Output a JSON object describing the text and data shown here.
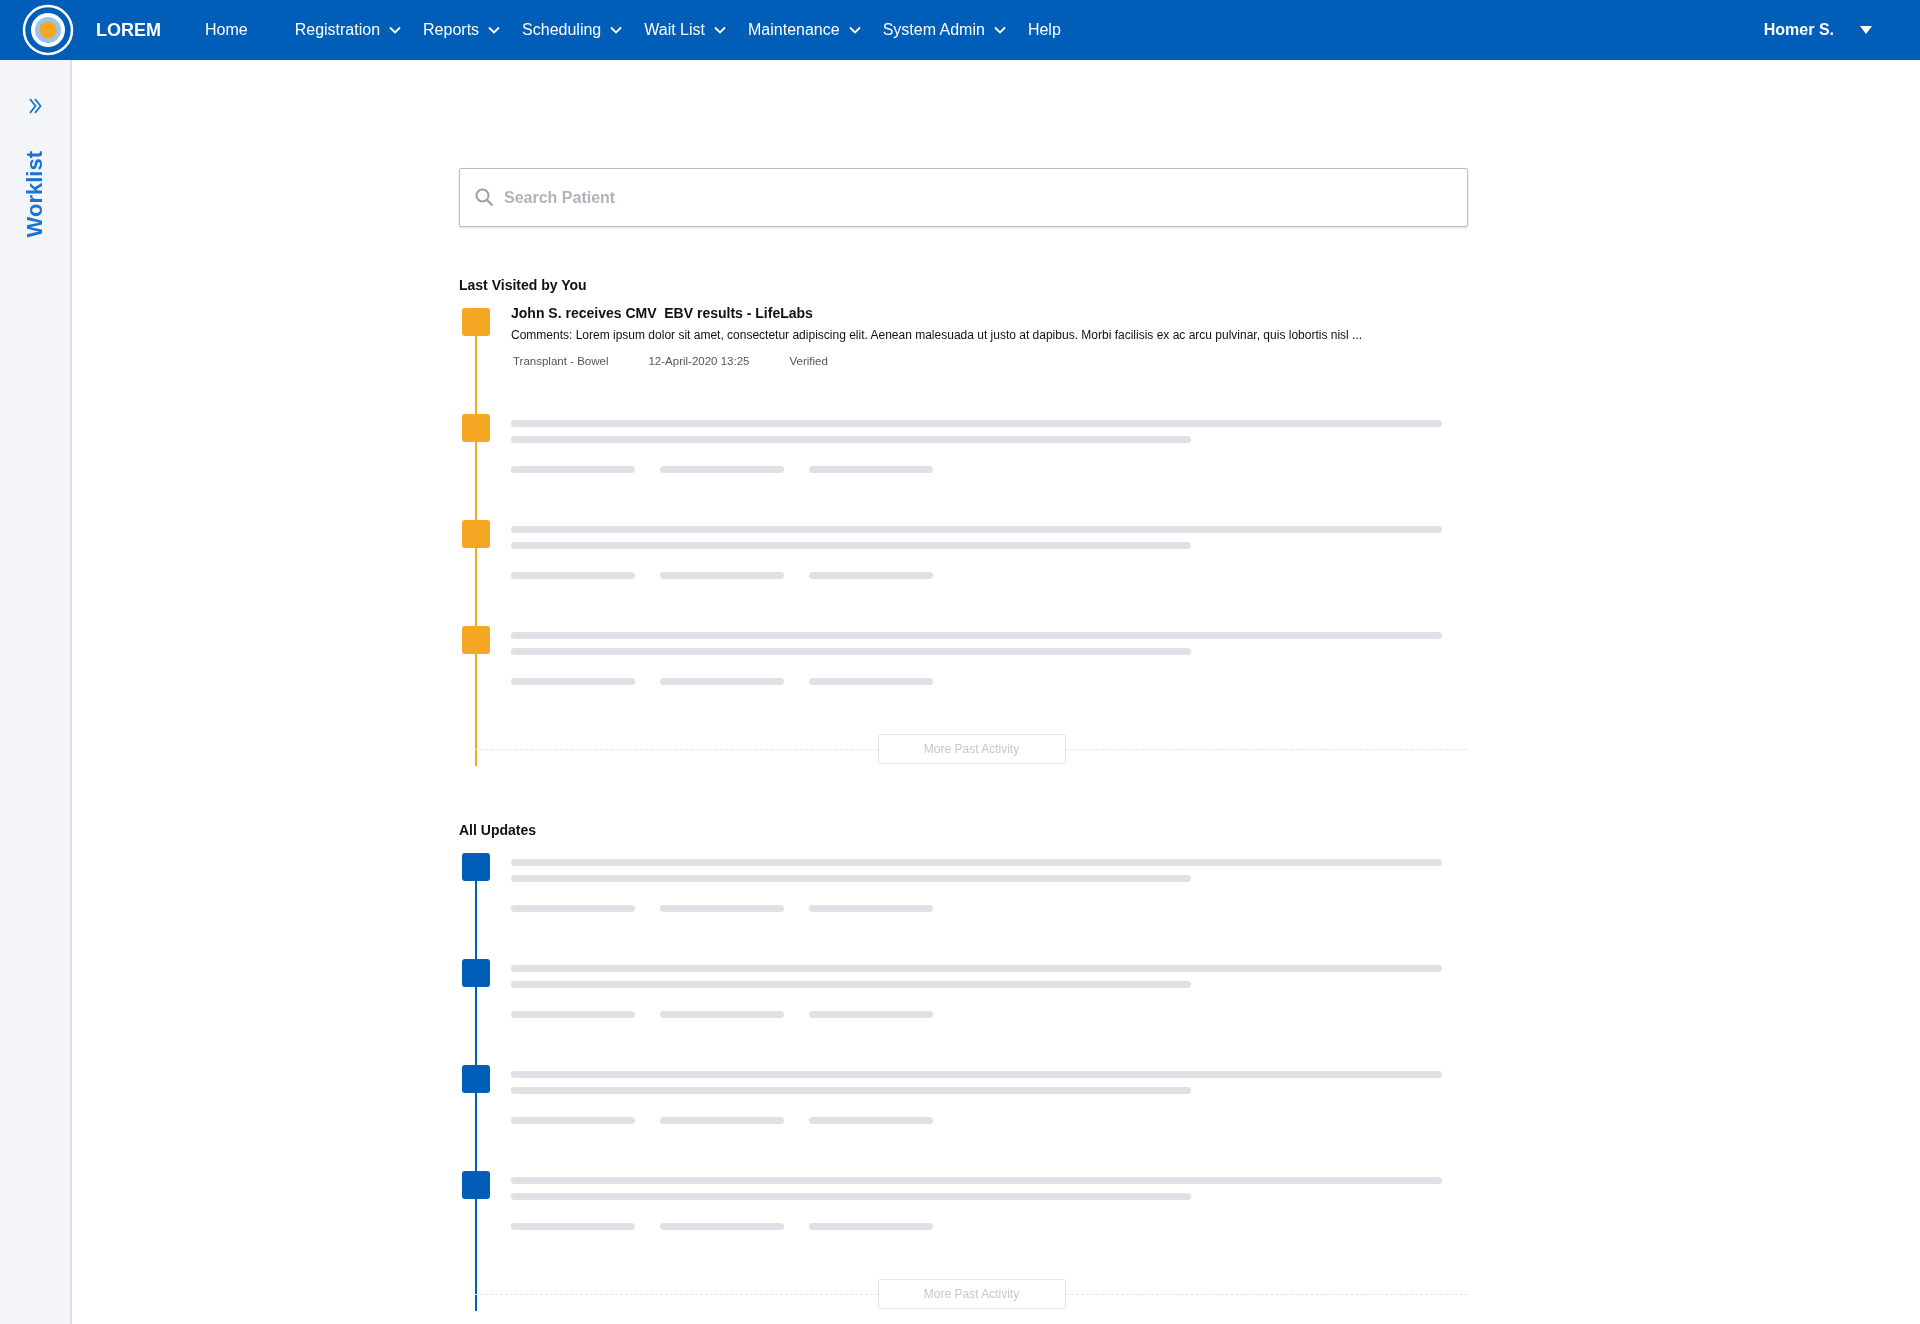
{
  "brand": {
    "name": "LOREM"
  },
  "nav": [
    {
      "label": "Home",
      "has_dropdown": false
    },
    {
      "label": "Registration",
      "has_dropdown": true
    },
    {
      "label": "Reports",
      "has_dropdown": true
    },
    {
      "label": "Scheduling",
      "has_dropdown": true
    },
    {
      "label": "Wait List",
      "has_dropdown": true
    },
    {
      "label": "Maintenance",
      "has_dropdown": true
    },
    {
      "label": "System Admin",
      "has_dropdown": true
    },
    {
      "label": "Help",
      "has_dropdown": false
    }
  ],
  "user": {
    "name": "Homer S."
  },
  "sidebar": {
    "label": "Worklist"
  },
  "search": {
    "placeholder": "Search Patient"
  },
  "sections": [
    {
      "title": "Last Visited by You",
      "color": "#f5a623",
      "more_button": "More Past Activity",
      "items": [
        {
          "kind": "entry",
          "title": "John S. receives CMV  EBV results - LifeLabs",
          "comment": "Comments: Lorem ipsum dolor sit amet, consectetur adipiscing elit. Aenean malesuada ut justo at dapibus. Morbi facilisis ex ac arcu pulvinar, quis lobortis nisl ...",
          "meta": [
            "Transplant - Bowel",
            "12-April-2020  13:25",
            "Verified"
          ]
        },
        {
          "kind": "placeholder"
        },
        {
          "kind": "placeholder"
        },
        {
          "kind": "placeholder"
        }
      ]
    },
    {
      "title": "All Updates",
      "color": "#005eb8",
      "more_button": "More Past Activity",
      "items": [
        {
          "kind": "placeholder"
        },
        {
          "kind": "placeholder"
        },
        {
          "kind": "placeholder"
        },
        {
          "kind": "placeholder"
        }
      ]
    }
  ]
}
